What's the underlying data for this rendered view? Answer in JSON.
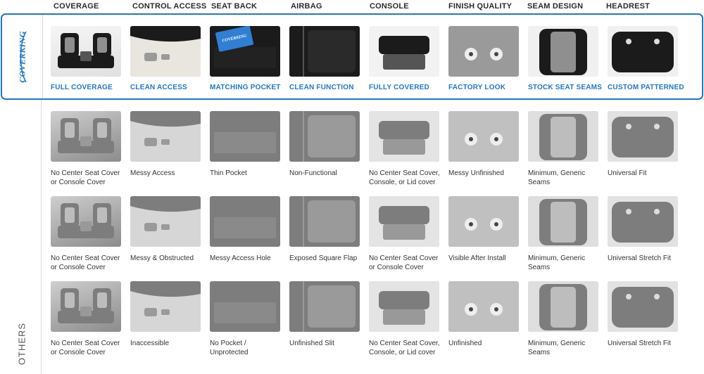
{
  "columns": [
    "COVERAGE",
    "CONTROL ACCESS",
    "SEAT BACK",
    "AIRBAG",
    "CONSOLE",
    "FINISH QUALITY",
    "SEAM DESIGN",
    "HEADREST"
  ],
  "brand": {
    "logo_text": "COVERKING",
    "captions": [
      "FULL COVERAGE",
      "CLEAN ACCESS",
      "MATCHING POCKET",
      "CLEAN FUNCTION",
      "FULLY COVERED",
      "FACTORY LOOK",
      "STOCK SEAT SEAMS",
      "CUSTOM PATTERNED"
    ],
    "pocket_card_text": "COVERKING"
  },
  "others_label": "OTHERS",
  "others_rows": [
    {
      "captions": [
        [
          "No Center Seat Cover",
          "or Console Cover"
        ],
        [
          "Messy Access",
          ""
        ],
        [
          "Thin Pocket",
          ""
        ],
        [
          "Non-Functional",
          ""
        ],
        [
          "No Center Seat Cover,",
          "Console, or Lid cover"
        ],
        [
          "Messy Unfinished",
          ""
        ],
        [
          "Minimum, Generic",
          "Seams"
        ],
        [
          "Universal Fit",
          ""
        ]
      ]
    },
    {
      "captions": [
        [
          "No Center Seat Cover",
          "or Console Cover"
        ],
        [
          "Messy & Obstructed",
          ""
        ],
        [
          "Messy Access Hole",
          ""
        ],
        [
          "Exposed Square Flap",
          ""
        ],
        [
          "No Center Seat Cover",
          "or Console Cover"
        ],
        [
          "Visible After Install",
          ""
        ],
        [
          "Minimum, Generic",
          "Seams"
        ],
        [
          "Universal Stretch Fit",
          ""
        ]
      ]
    },
    {
      "captions": [
        [
          "No Center Seat Cover",
          "or Console Cover"
        ],
        [
          "Inaccessible",
          ""
        ],
        [
          "No Pocket /",
          "Unprotected"
        ],
        [
          "Unfinished Slit",
          ""
        ],
        [
          "No Center Seat Cover,",
          "Console, or Lid cover"
        ],
        [
          "Unfinished",
          ""
        ],
        [
          "Minimum, Generic",
          "Seams"
        ],
        [
          "Universal Stretch Fit",
          ""
        ]
      ]
    }
  ],
  "colors": {
    "accent": "#1f78c8",
    "divider": "#d9d9d9"
  }
}
